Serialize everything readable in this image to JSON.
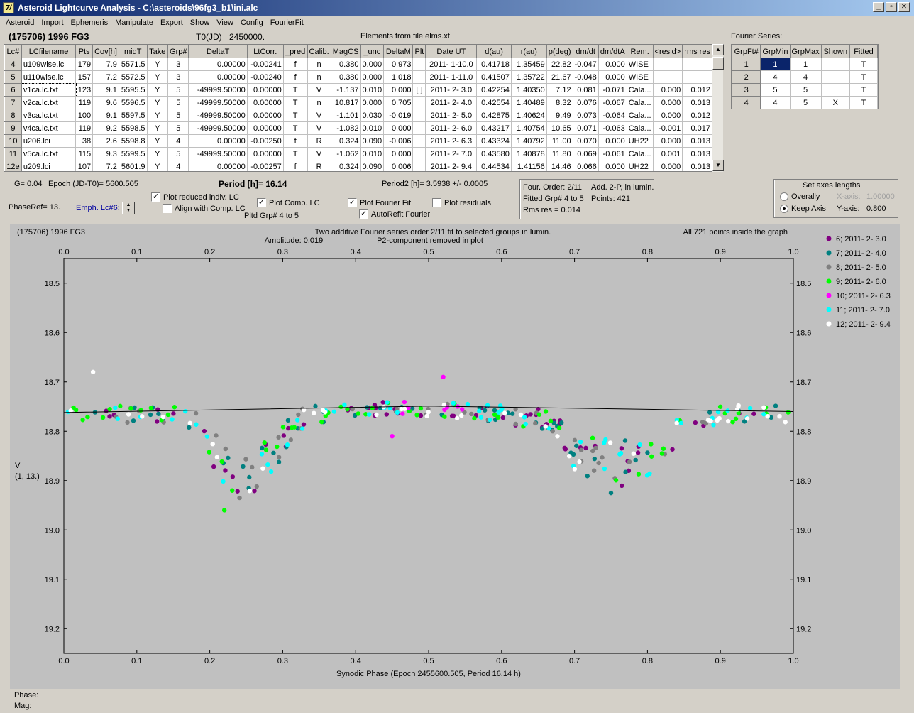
{
  "window": {
    "title": "Asteroid Lightcurve Analysis - C:\\asteroids\\96fg3_b1\\ini.alc",
    "icon": "7/",
    "buttons": [
      "_",
      "▫",
      "✕"
    ]
  },
  "menu": [
    "Asteroid",
    "Import",
    "Ephemeris",
    "Manipulate",
    "Export",
    "Show",
    "View",
    "Config",
    "FourierFit"
  ],
  "header": {
    "object": "(175706) 1996 FG3",
    "t0": "T0(JD)= 2450000.",
    "elements": "Elements from file elms.xt",
    "fourier_series_label": "Fourier Series:"
  },
  "lc_table": {
    "columns": [
      "Lc#",
      "LCfilename",
      "Pts",
      "Cov[h]",
      "midT",
      "Take",
      "Grp#",
      "DeltaT",
      "LtCorr.",
      "_pred",
      "Calib.",
      "MagCS",
      "_unc",
      "DeltaM",
      "Plt",
      "Date UT",
      "d(au)",
      "r(au)",
      "p(deg)",
      "dm/dt",
      "dm/dtA",
      "Rem.",
      "<resid>",
      "rms res"
    ],
    "rows": [
      [
        "4",
        "u109wise.lc",
        "179",
        "7.9",
        "5571.5",
        "Y",
        "3",
        "0.00000",
        "-0.00241",
        "f",
        "n",
        "0.380",
        "0.000",
        "0.973",
        "",
        "2011- 1-10.0",
        "0.41718",
        "1.35459",
        "22.82",
        "-0.047",
        "0.000",
        "WISE",
        "",
        ""
      ],
      [
        "5",
        "u110wise.lc",
        "157",
        "7.2",
        "5572.5",
        "Y",
        "3",
        "0.00000",
        "-0.00240",
        "f",
        "n",
        "0.380",
        "0.000",
        "1.018",
        "",
        "2011- 1-11.0",
        "0.41507",
        "1.35722",
        "21.67",
        "-0.048",
        "0.000",
        "WISE",
        "",
        ""
      ],
      [
        "6",
        "v1ca.lc.txt",
        "123",
        "9.1",
        "5595.5",
        "Y",
        "5",
        "-49999.50000",
        "0.00000",
        "T",
        "V",
        "-1.137",
        "0.010",
        "0.000",
        "[ ]",
        "2011- 2- 3.0",
        "0.42254",
        "1.40350",
        "7.12",
        "0.081",
        "-0.071",
        "Cala...",
        "0.000",
        "0.012"
      ],
      [
        "7",
        "v2ca.lc.txt",
        "119",
        "9.6",
        "5596.5",
        "Y",
        "5",
        "-49999.50000",
        "0.00000",
        "T",
        "n",
        "10.817",
        "0.000",
        "0.705",
        "",
        "2011- 2- 4.0",
        "0.42554",
        "1.40489",
        "8.32",
        "0.076",
        "-0.067",
        "Cala...",
        "0.000",
        "0.013"
      ],
      [
        "8",
        "v3ca.lc.txt",
        "100",
        "9.1",
        "5597.5",
        "Y",
        "5",
        "-49999.50000",
        "0.00000",
        "T",
        "V",
        "-1.101",
        "0.030",
        "-0.019",
        "",
        "2011- 2- 5.0",
        "0.42875",
        "1.40624",
        "9.49",
        "0.073",
        "-0.064",
        "Cala...",
        "0.000",
        "0.012"
      ],
      [
        "9",
        "v4ca.lc.txt",
        "119",
        "9.2",
        "5598.5",
        "Y",
        "5",
        "-49999.50000",
        "0.00000",
        "T",
        "V",
        "-1.082",
        "0.010",
        "0.000",
        "",
        "2011- 2- 6.0",
        "0.43217",
        "1.40754",
        "10.65",
        "0.071",
        "-0.063",
        "Cala...",
        "-0.001",
        "0.017"
      ],
      [
        "10",
        "u206.lci",
        "38",
        "2.6",
        "5598.8",
        "Y",
        "4",
        "0.00000",
        "-0.00250",
        "f",
        "R",
        "0.324",
        "0.090",
        "-0.006",
        "",
        "2011- 2- 6.3",
        "0.43324",
        "1.40792",
        "11.00",
        "0.070",
        "0.000",
        "UH22",
        "0.000",
        "0.013"
      ],
      [
        "11",
        "v5ca.lc.txt",
        "115",
        "9.3",
        "5599.5",
        "Y",
        "5",
        "-49999.50000",
        "0.00000",
        "T",
        "V",
        "-1.062",
        "0.010",
        "0.000",
        "",
        "2011- 2- 7.0",
        "0.43580",
        "1.40878",
        "11.80",
        "0.069",
        "-0.061",
        "Cala...",
        "0.001",
        "0.013"
      ],
      [
        "12e",
        "u209.lci",
        "107",
        "7.2",
        "5601.9",
        "Y",
        "4",
        "0.00000",
        "-0.00257",
        "f",
        "R",
        "0.324",
        "0.090",
        "0.006",
        "",
        "2011- 2- 9.4",
        "0.44534",
        "1.41156",
        "14.46",
        "0.066",
        "0.000",
        "UH22",
        "0.000",
        "0.013"
      ]
    ]
  },
  "fourier_table": {
    "columns": [
      "GrpFt#",
      "GrpMin",
      "GrpMax",
      "Shown",
      "Fitted"
    ],
    "rows": [
      [
        "1",
        "1",
        "1",
        "",
        "T"
      ],
      [
        "2",
        "4",
        "4",
        "",
        "T"
      ],
      [
        "3",
        "5",
        "5",
        "",
        "T"
      ],
      [
        "4",
        "4",
        "5",
        "X",
        "T"
      ]
    ]
  },
  "info": {
    "g": "G= 0.04",
    "epoch": "Epoch (JD-T0)= 5600.505",
    "period": "Period [h]= 16.14",
    "period2": "Period2 [h]= 3.5938 +/- 0.0005",
    "phase_ref": "PhaseRef= 13.",
    "emph": "Emph. Lc#6:",
    "pltd_grp": "Pltd Grp#  4   to   5"
  },
  "checkboxes": {
    "plot_reduced": {
      "label": "Plot reduced indiv. LC",
      "checked": true
    },
    "align_comp": {
      "label": "Align with Comp. LC",
      "checked": false
    },
    "plot_comp": {
      "label": "Plot Comp. LC",
      "checked": true
    },
    "plot_fourier": {
      "label": "Plot Fourier Fit",
      "checked": true
    },
    "plot_residuals": {
      "label": "Plot residuals",
      "checked": false
    },
    "autorefit": {
      "label": "AutoRefit Fourier",
      "checked": true
    }
  },
  "fit_info": {
    "order": "Four. Order:  2/11",
    "add": "Add. 2-P, in lumin.",
    "fitted": "Fitted Grp# 4 to 5",
    "points": "Points: 421",
    "rms": "Rms res     = 0.014"
  },
  "axes_box": {
    "title": "Set axes lengths",
    "overally": "Overally",
    "keep_axis": "Keep Axis",
    "x_axis_label": "X-axis:",
    "x_axis_value": "1.00000",
    "y_axis_label": "Y-axis:",
    "y_axis_value": "0.800",
    "selected": "keep_axis"
  },
  "plot": {
    "object": "(175706) 1996 FG3",
    "title1": "Two additive Fourier series order 2/11 fit to selected groups in lumin.",
    "amplitude": "Amplitude: 0.019",
    "p2": "P2-component removed in plot",
    "inside": "All 721 points inside the graph",
    "ylabel1": "V",
    "ylabel2": "(1, 13.)",
    "xlabel": "Synodic Phase (Epoch 2455600.505, Period 16.14 h)",
    "legend": [
      {
        "label": "6; 2011- 2- 3.0",
        "color": "#800080"
      },
      {
        "label": "7; 2011- 2- 4.0",
        "color": "#008080"
      },
      {
        "label": "8; 2011- 2- 5.0",
        "color": "#808080"
      },
      {
        "label": "9; 2011- 2- 6.0",
        "color": "#00ff00"
      },
      {
        "label": "10; 2011- 2- 6.3",
        "color": "#ff00ff"
      },
      {
        "label": "11; 2011- 2- 7.0",
        "color": "#00ffff"
      },
      {
        "label": "12; 2011- 2- 9.4",
        "color": "#ffffff"
      }
    ]
  },
  "chart_data": {
    "type": "scatter",
    "xlim": [
      0.0,
      1.0
    ],
    "ylim": [
      19.25,
      18.45
    ],
    "x_ticks": [
      "0.0",
      "0.1",
      "0.2",
      "0.3",
      "0.4",
      "0.5",
      "0.6",
      "0.7",
      "0.8",
      "0.9",
      "1.0"
    ],
    "y_ticks": [
      "18.5",
      "18.6",
      "18.7",
      "18.8",
      "18.9",
      "19.0",
      "19.1",
      "19.2"
    ],
    "fit_line": [
      [
        0.0,
        18.762
      ],
      [
        0.5,
        18.749
      ],
      [
        1.0,
        18.76
      ]
    ],
    "lightcurve_shape": [
      [
        0.0,
        18.765
      ],
      [
        0.15,
        18.765
      ],
      [
        0.18,
        18.78
      ],
      [
        0.2,
        18.83
      ],
      [
        0.23,
        18.89
      ],
      [
        0.26,
        18.89
      ],
      [
        0.3,
        18.82
      ],
      [
        0.33,
        18.77
      ],
      [
        0.4,
        18.755
      ],
      [
        0.5,
        18.755
      ],
      [
        0.6,
        18.765
      ],
      [
        0.67,
        18.78
      ],
      [
        0.7,
        18.84
      ],
      [
        0.75,
        18.865
      ],
      [
        0.8,
        18.86
      ],
      [
        0.83,
        18.82
      ],
      [
        0.86,
        18.78
      ],
      [
        0.9,
        18.765
      ],
      [
        1.0,
        18.765
      ]
    ],
    "outliers": [
      [
        0.04,
        18.68
      ],
      [
        0.52,
        18.69
      ],
      [
        0.75,
        18.925
      ],
      [
        0.22,
        18.96
      ],
      [
        0.45,
        18.81
      ]
    ],
    "grid": false,
    "legend_position": "right"
  },
  "status": {
    "phase": "Phase:",
    "mag": "Mag:"
  }
}
